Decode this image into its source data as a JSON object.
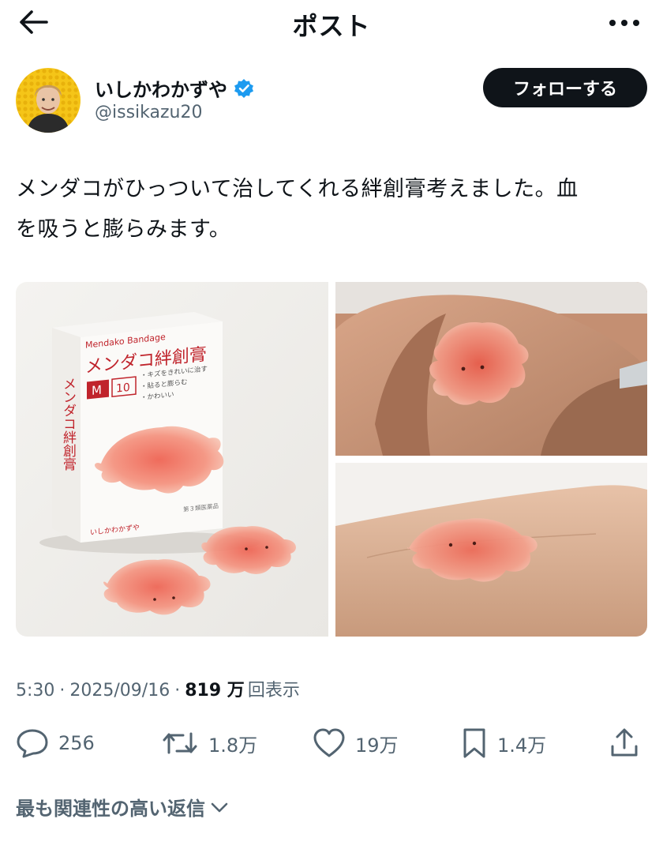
{
  "header": {
    "title": "ポスト",
    "back_icon": "arrow-left-icon",
    "more_icon": "more-horizontal-icon"
  },
  "author": {
    "display_name": "いしかわかずや",
    "handle": "@issikazu20",
    "verified": true,
    "verified_color": "#1d9bf0",
    "follow_label": "フォローする"
  },
  "post": {
    "text_line1": "メンダコがひっついて治してくれる絆創膏考えました。血",
    "text_line2": "を吸うと膨らみます。"
  },
  "media": {
    "product": {
      "brand_en": "Mendako Bandage",
      "title": "メンダコ絆創膏",
      "size_label": "M",
      "count_label": "10",
      "features": [
        "・キズをきれいに治す",
        "・貼ると膨らむ",
        "・かわいい"
      ],
      "category_label": "第３類医薬品",
      "maker": "いしかわかずや",
      "side_text": "メンダコ絆創膏"
    }
  },
  "meta": {
    "time": "5:30",
    "separator": "·",
    "date": "2025/09/16",
    "views_count": "819 万",
    "views_label": "回表示"
  },
  "actions": {
    "replies": "256",
    "reposts": "1.8万",
    "likes": "19万",
    "bookmarks": "1.4万"
  },
  "replies_sort": {
    "label": "最も関連性の高い返信"
  },
  "colors": {
    "text": "#0f1419",
    "secondary": "#536471",
    "accent": "#1d9bf0",
    "brand_red": "#c0242c"
  }
}
